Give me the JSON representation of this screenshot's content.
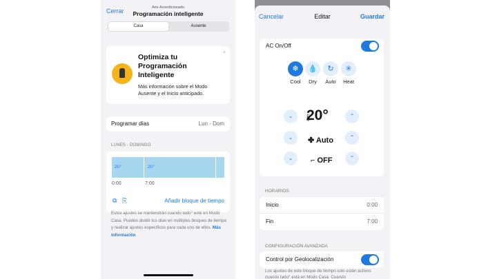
{
  "left": {
    "close": "Cerrar",
    "subtitle": "Aire Acondicionado",
    "title": "Programación inteligente",
    "tabs": [
      "Casa",
      "Ausente"
    ],
    "promo": {
      "title": "Optimiza tu Programación Inteligente",
      "text": "Más información sobre el Modo Ausente y el Inicio anticipado.",
      "close": "×"
    },
    "program": {
      "label": "Programar días",
      "value": "Lun - Dom"
    },
    "section": "LUNES - DOMINGO",
    "blocks": [
      {
        "temp": "20°",
        "time": "0:00"
      },
      {
        "temp": "20°",
        "time": "7:00"
      }
    ],
    "add_block": "Añadir bloque de tiempo",
    "footer": "Estos ajustes se mantendrán cuando tado° esté en Modo Casa. Puedes dividir tus días en múltiples bloques de tiempo y realizar ajustes específicos para cada uno de ellos.",
    "footer_link": "Más información"
  },
  "right": {
    "cancel": "Cancelar",
    "title": "Editar",
    "save": "Guardar",
    "ac_label": "AC On/Off",
    "modes": [
      {
        "label": "Cool",
        "icon": "snowflake-icon",
        "glyph": "❄"
      },
      {
        "label": "Dry",
        "icon": "drop-icon",
        "glyph": "💧"
      },
      {
        "label": "Auto",
        "icon": "auto-icon",
        "glyph": "↻"
      },
      {
        "label": "Heat",
        "icon": "heat-icon",
        "glyph": "✳"
      }
    ],
    "temperature": "20°",
    "fan": "Auto",
    "swing": "OFF",
    "sections": {
      "schedule": "HORARIOS",
      "advanced": "CONFIGURACIÓN AVANZADA"
    },
    "start": {
      "label": "Inicio",
      "value": "0:00"
    },
    "end": {
      "label": "Fin",
      "value": "7:00"
    },
    "geo": "Control por Geolocalización",
    "footer": "Los ajustes de este bloque de tiempo solo están activos cuando tado° está en Modo Casa. Cuando"
  },
  "colors": {
    "accent": "#1f7ae0",
    "bar": "#a7d6f1"
  }
}
